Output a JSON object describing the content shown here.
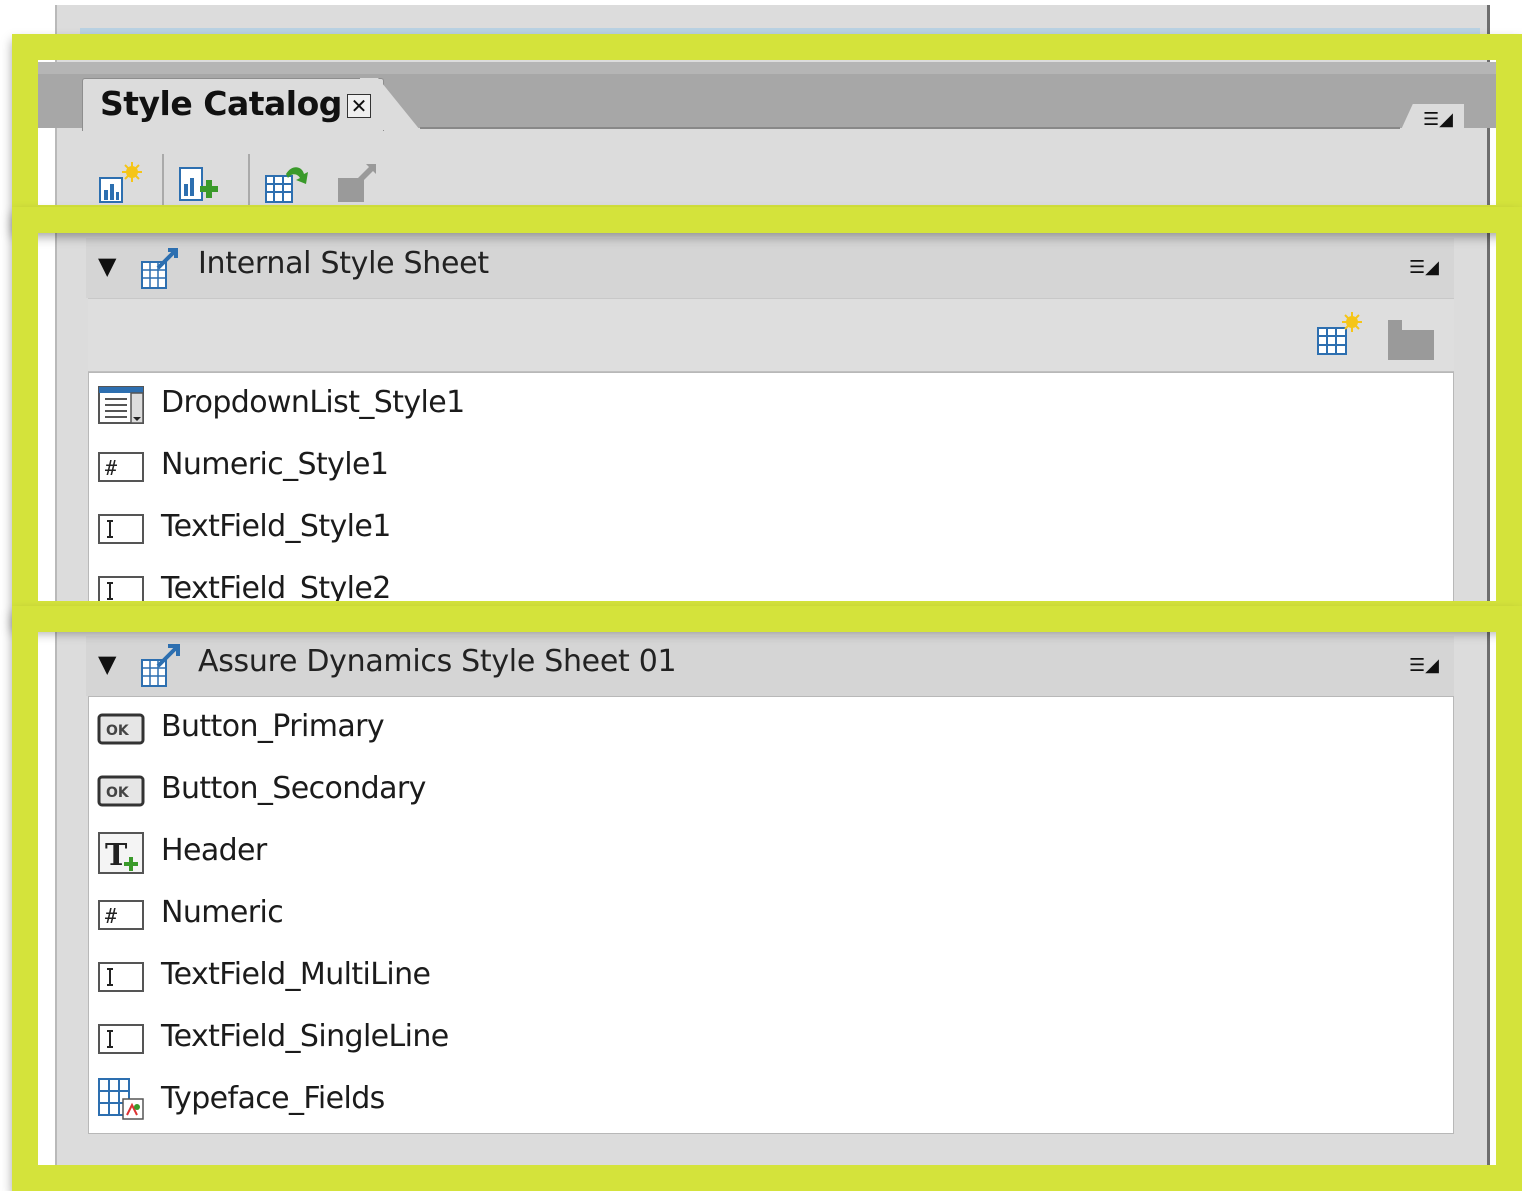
{
  "panel": {
    "tab_title": "Style Catalog",
    "close_symbol": "✕",
    "menu_symbol": "☰◢"
  },
  "toolbar": {
    "buttons": [
      {
        "icon": "new-style-icon"
      },
      {
        "icon": "add-style-sheet-icon"
      },
      {
        "icon": "import-style-sheet-icon"
      },
      {
        "icon": "export-style-sheet-icon"
      }
    ]
  },
  "internal": {
    "title": "Internal Style Sheet",
    "items": [
      {
        "label": "DropdownList_Style1",
        "icon": "dropdown-field-icon"
      },
      {
        "label": "Numeric_Style1",
        "icon": "numeric-field-icon"
      },
      {
        "label": "TextField_Style1",
        "icon": "text-field-icon"
      },
      {
        "label": "TextField_Style2",
        "icon": "text-field-icon"
      }
    ]
  },
  "assure": {
    "title": "Assure Dynamics Style Sheet 01",
    "items": [
      {
        "label": "Button_Primary",
        "icon": "button-ok-icon"
      },
      {
        "label": "Button_Secondary",
        "icon": "button-ok-icon"
      },
      {
        "label": "Header",
        "icon": "text-header-icon"
      },
      {
        "label": "Numeric",
        "icon": "numeric-field-icon"
      },
      {
        "label": "TextField_MultiLine",
        "icon": "text-field-icon"
      },
      {
        "label": "TextField_SingleLine",
        "icon": "text-field-icon"
      },
      {
        "label": "Typeface_Fields",
        "icon": "typeface-fields-icon"
      }
    ]
  },
  "colors": {
    "highlight": "#d4e33b",
    "panel_bg": "#dcdcdc",
    "tabbar": "#a7a7a7",
    "icon_blue": "#2d6fb0",
    "icon_green": "#3a9a2a"
  }
}
